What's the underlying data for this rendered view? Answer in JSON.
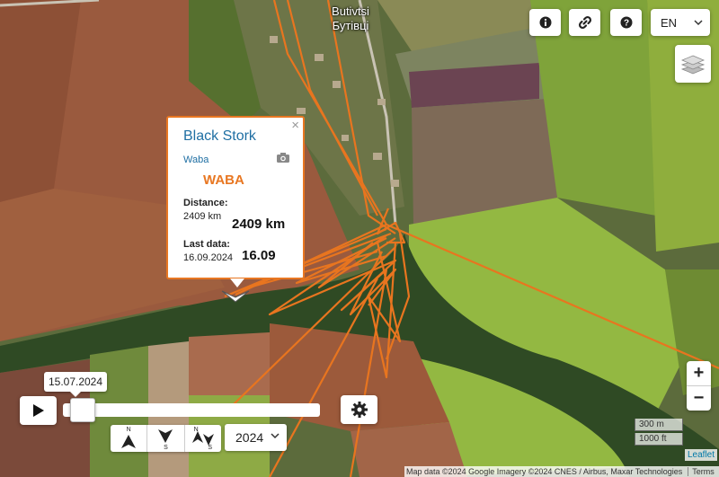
{
  "map": {
    "town_latin": "Butivtsi",
    "town_cyrillic": "Бутівці",
    "track_color": "#e8751f"
  },
  "controls": {
    "info_icon": "info-icon",
    "link_icon": "link-icon",
    "help_icon": "help-icon",
    "language": "EN",
    "layers_icon": "layers-icon",
    "zoom_in": "+",
    "zoom_out": "−"
  },
  "popup": {
    "close": "×",
    "title": "Black Stork",
    "name": "Waba",
    "code": "WABA",
    "distance_label": "Distance:",
    "distance_small": "2409 km",
    "distance_big": "2409 km",
    "last_data_label": "Last data:",
    "last_data_small": "16.09.2024",
    "last_data_big": "16.09"
  },
  "timeline": {
    "current_date": "15.07.2024",
    "progress": 0.03,
    "year": "2024",
    "dir_n": "N",
    "dir_s": "S",
    "dir_ns_n": "N",
    "dir_ns_s": "S"
  },
  "scale": {
    "metric": "300 m",
    "imperial": "1000 ft"
  },
  "attribution": {
    "text": "Map data ©2024 Google Imagery ©2024 CNES / Airbus, Maxar Technologies",
    "terms": "Terms",
    "leaflet": "Leaflet"
  }
}
